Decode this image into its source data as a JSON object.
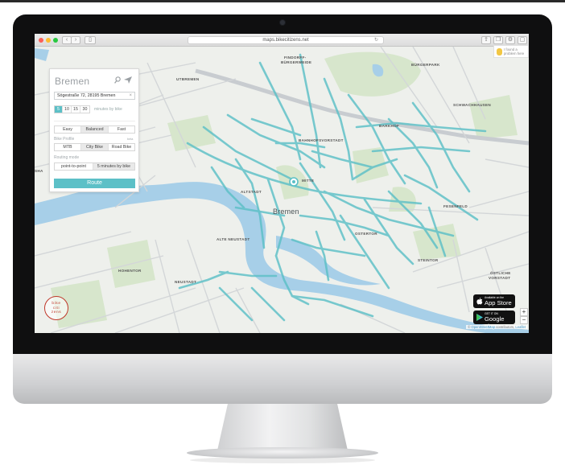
{
  "browser": {
    "url": "maps.bikecitizens.net"
  },
  "panel": {
    "city": "Bremen",
    "address": "Sögestraße 72, 28195 Bremen",
    "clear_symbol": "×",
    "minutes_options": [
      "5",
      "10",
      "15",
      "30"
    ],
    "minutes_selected": "5",
    "minutes_caption": "minutes by bike",
    "effort_options": [
      "Easy",
      "Balanced",
      "Fast"
    ],
    "effort_selected": "Balanced",
    "bike_profile_label": "Bike Profile",
    "bike_profile_aside": "beta",
    "bike_profiles": [
      "MTB",
      "City Bike",
      "Road Bike"
    ],
    "bike_profile_selected": "City Bike",
    "routing_mode_label": "Routing mode",
    "routing_modes": [
      "point-to-point",
      "5 minutes by bike"
    ],
    "route_button": "Route"
  },
  "notification": {
    "text": "I found a problem here"
  },
  "logo": {
    "line1": "bike",
    "line2": "citi",
    "line3": "zens"
  },
  "app_store": {
    "small": "Available on the",
    "large": "App Store"
  },
  "google_play": {
    "small": "GET IT ON",
    "large": "Google play"
  },
  "zoom": {
    "in": "+",
    "out": "−"
  },
  "attribution": {
    "prefix": "©",
    "link": "OpenStreetMap",
    "mid": "contributors,",
    "leaflet": "Leaflet"
  },
  "map_labels": {
    "findorff": "FINDORFF-",
    "findorff2": "BÜRGERWEIDE",
    "burgerpark": "BÜRGERPARK",
    "utbremen": "UTBREMEN",
    "schwachhausen": "SCHWACHHAUSEN",
    "barkhof": "BARKHOF",
    "bahnhofsvorstadt": "BAHNHOFSVORSTADT",
    "mitte": "MITTE",
    "altstadt": "ALTSTADT",
    "city": "Bremen",
    "fesenfeld": "FESENFELD",
    "ostertor": "OSTERTOR",
    "alteneustadt": "ALTE NEUSTADT",
    "hohentor": "HOHENTOR",
    "neustadt": "NEUSTADT",
    "steintor": "STEINTOR",
    "oestliche": "ÖSTLICHE",
    "oestliche2": "VORSTADT",
    "sha": "SHA"
  },
  "colors": {
    "route": "#5cc0c7",
    "water": "#a7cfe8",
    "accent_red": "#c0392b"
  }
}
